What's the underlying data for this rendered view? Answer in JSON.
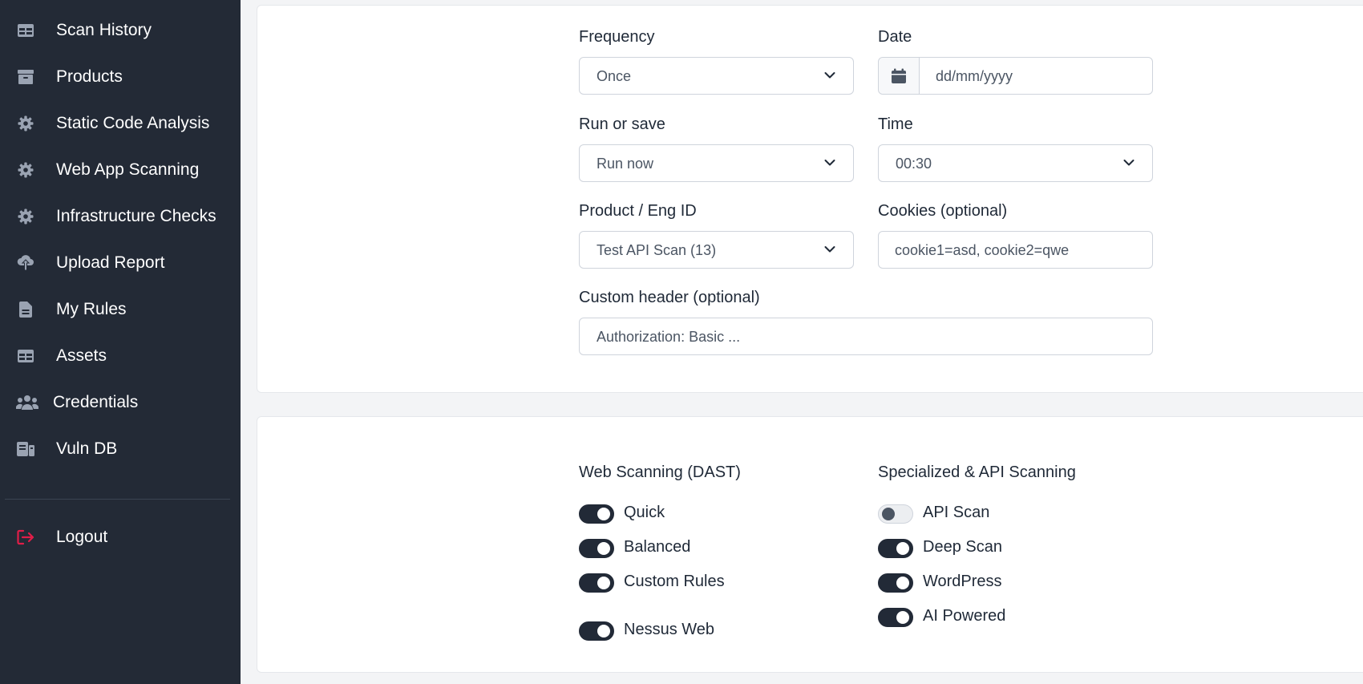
{
  "sidebar": {
    "items": [
      {
        "label": "Scan History",
        "icon": "table-icon"
      },
      {
        "label": "Products",
        "icon": "archive-icon"
      },
      {
        "label": "Static Code Analysis",
        "icon": "gear-icon"
      },
      {
        "label": "Web App Scanning",
        "icon": "gear-icon"
      },
      {
        "label": "Infrastructure Checks",
        "icon": "gear-icon"
      },
      {
        "label": "Upload Report",
        "icon": "cloud-upload-icon"
      },
      {
        "label": "My Rules",
        "icon": "document-icon"
      },
      {
        "label": "Assets",
        "icon": "table-icon"
      },
      {
        "label": "Credentials",
        "icon": "users-icon"
      },
      {
        "label": "Vuln DB",
        "icon": "database-icon"
      }
    ],
    "logout": {
      "label": "Logout",
      "icon": "logout-icon",
      "color": "#e11d48"
    }
  },
  "form": {
    "frequency": {
      "label": "Frequency",
      "value": "Once"
    },
    "date": {
      "label": "Date",
      "placeholder": "dd/mm/yyyy"
    },
    "run_or_save": {
      "label": "Run or save",
      "value": "Run now"
    },
    "time": {
      "label": "Time",
      "value": "00:30"
    },
    "product": {
      "label": "Product / Eng ID",
      "value": "Test API Scan (13)"
    },
    "cookies": {
      "label": "Cookies (optional)",
      "placeholder": "cookie1=asd, cookie2=qwe"
    },
    "custom_header": {
      "label": "Custom header (optional)",
      "placeholder": "Authorization: Basic ..."
    }
  },
  "scan_types": {
    "web": {
      "title": "Web Scanning (DAST)",
      "toggles": [
        {
          "label": "Quick",
          "on": true
        },
        {
          "label": "Balanced",
          "on": true
        },
        {
          "label": "Custom Rules",
          "on": true
        },
        {
          "label": "Nessus Web",
          "on": true
        }
      ]
    },
    "api": {
      "title": "Specialized & API Scanning",
      "toggles": [
        {
          "label": "API Scan",
          "on": false
        },
        {
          "label": "Deep Scan",
          "on": true
        },
        {
          "label": "WordPress",
          "on": true
        },
        {
          "label": "AI Powered",
          "on": true
        }
      ]
    }
  },
  "colors": {
    "sidebar_bg": "#232a36",
    "toggle_on": "#222a37",
    "accent_logout": "#e11d48"
  }
}
